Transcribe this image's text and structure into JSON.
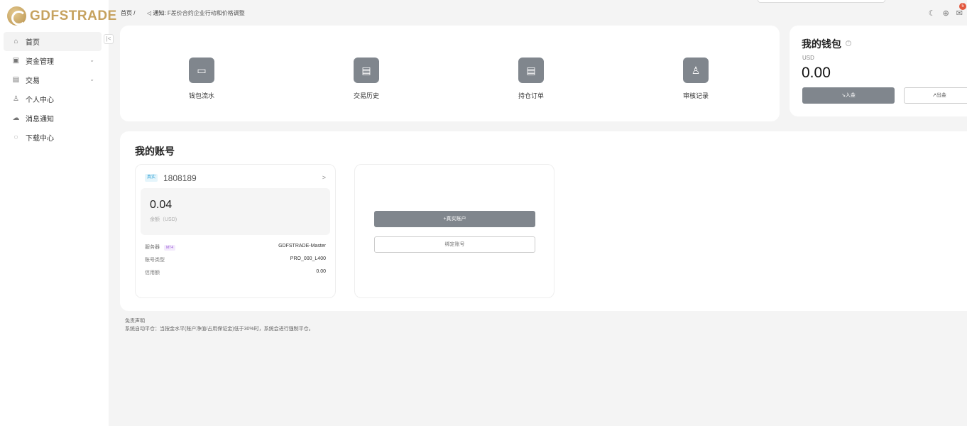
{
  "brand": {
    "name": "GDFSTRADE"
  },
  "sidebar": {
    "items": [
      {
        "label": "首页",
        "icon": "home-icon",
        "glyph": "⌂"
      },
      {
        "label": "资金管理",
        "icon": "wallet-icon",
        "glyph": "▣"
      },
      {
        "label": "交易",
        "icon": "trade-icon",
        "glyph": "▤"
      },
      {
        "label": "个人中心",
        "icon": "user-icon",
        "glyph": "♙"
      },
      {
        "label": "消息通知",
        "icon": "message-icon",
        "glyph": "☁"
      },
      {
        "label": "下载中心",
        "icon": "download-icon",
        "glyph": "◌"
      }
    ],
    "collapse_glyph": "|<",
    "chevron": "⌄"
  },
  "header": {
    "breadcrumb": "首页 /",
    "notice_label": "通知:",
    "notice_icon": "◁",
    "notice_text": "F差价合约企业行动和价格调整",
    "theme_icon": "☾",
    "language_icon": "⊕",
    "mail_icon": "✉",
    "mail_badge": "5"
  },
  "quick_actions": [
    {
      "label": "钱包流水",
      "icon": "wallet-flow-icon",
      "glyph": "▭"
    },
    {
      "label": "交易历史",
      "icon": "trade-history-icon",
      "glyph": "▤"
    },
    {
      "label": "持仓订单",
      "icon": "position-order-icon",
      "glyph": "▤"
    },
    {
      "label": "审核记录",
      "icon": "audit-stamp-icon",
      "glyph": "♙"
    }
  ],
  "wallet": {
    "title": "我的钱包",
    "help": "?",
    "currency": "USD",
    "balance": "0.00",
    "deposit_label": "↘入金",
    "withdraw_label": "↗出金"
  },
  "accounts": {
    "title": "我的账号",
    "card": {
      "tag": "真实",
      "number": "1808189",
      "arrow": ">",
      "balance": "0.04",
      "balance_label": "余额（USD)",
      "rows": [
        {
          "key": "服务器",
          "badge": "MT4",
          "value": "GDFSTRADE-Master"
        },
        {
          "key": "账号类型",
          "value": "PRO_000_L400"
        },
        {
          "key": "信用额",
          "value": "0.00"
        }
      ]
    },
    "add_real_label": "+真实账户",
    "bind_label": "绑定账号"
  },
  "disclaimer": {
    "title": "免责声明",
    "text": "系统自动平仓：当按金水平(账户净值/占用保证金)低于30%时，系统会进行强制平仓。"
  }
}
